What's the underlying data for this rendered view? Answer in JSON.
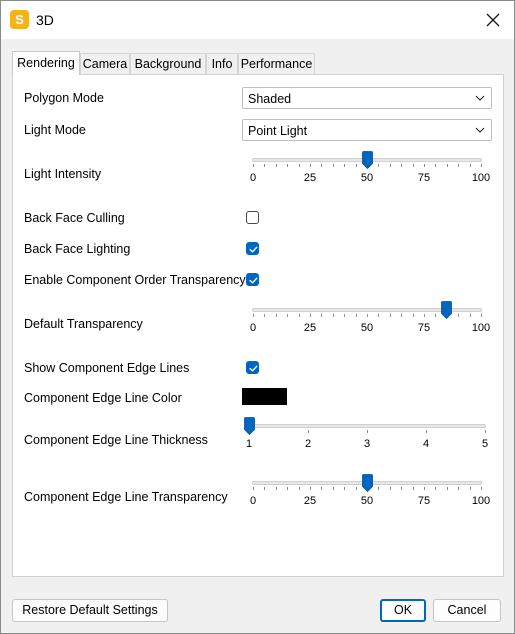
{
  "window": {
    "title": "3D",
    "app_icon_letter": "S"
  },
  "tabs": [
    "Rendering",
    "Camera",
    "Background",
    "Info",
    "Performance"
  ],
  "active_tab": "Rendering",
  "rendering": {
    "polygon_mode": {
      "label": "Polygon Mode",
      "value": "Shaded"
    },
    "light_mode": {
      "label": "Light Mode",
      "value": "Point Light"
    },
    "light_intensity": {
      "label": "Light Intensity",
      "value": 50,
      "min": 0,
      "max": 100,
      "tick_labels": [
        "0",
        "25",
        "50",
        "75",
        "100"
      ]
    },
    "back_face_culling": {
      "label": "Back Face Culling",
      "checked": false
    },
    "back_face_lighting": {
      "label": "Back Face Lighting",
      "checked": true
    },
    "component_order_transparency": {
      "label": "Enable Component Order Transparency",
      "checked": true
    },
    "default_transparency": {
      "label": "Default Transparency",
      "value": 85,
      "min": 0,
      "max": 100,
      "tick_labels": [
        "0",
        "25",
        "50",
        "75",
        "100"
      ]
    },
    "show_edge_lines": {
      "label": "Show Component Edge Lines",
      "checked": true
    },
    "edge_line_color": {
      "label": "Component Edge Line Color",
      "color": "#000000"
    },
    "edge_line_thickness": {
      "label": "Component Edge Line Thickness",
      "value": 1,
      "min": 1,
      "max": 5,
      "tick_labels": [
        "1",
        "2",
        "3",
        "4",
        "5"
      ]
    },
    "edge_line_transparency": {
      "label": "Component Edge Line Transparency",
      "value": 50,
      "min": 0,
      "max": 100,
      "tick_labels": [
        "0",
        "25",
        "50",
        "75",
        "100"
      ]
    }
  },
  "footer": {
    "restore_label": "Restore Default Settings",
    "ok_label": "OK",
    "cancel_label": "Cancel"
  },
  "colors": {
    "accent": "#0067c0",
    "app_icon": "#f6b21b"
  }
}
